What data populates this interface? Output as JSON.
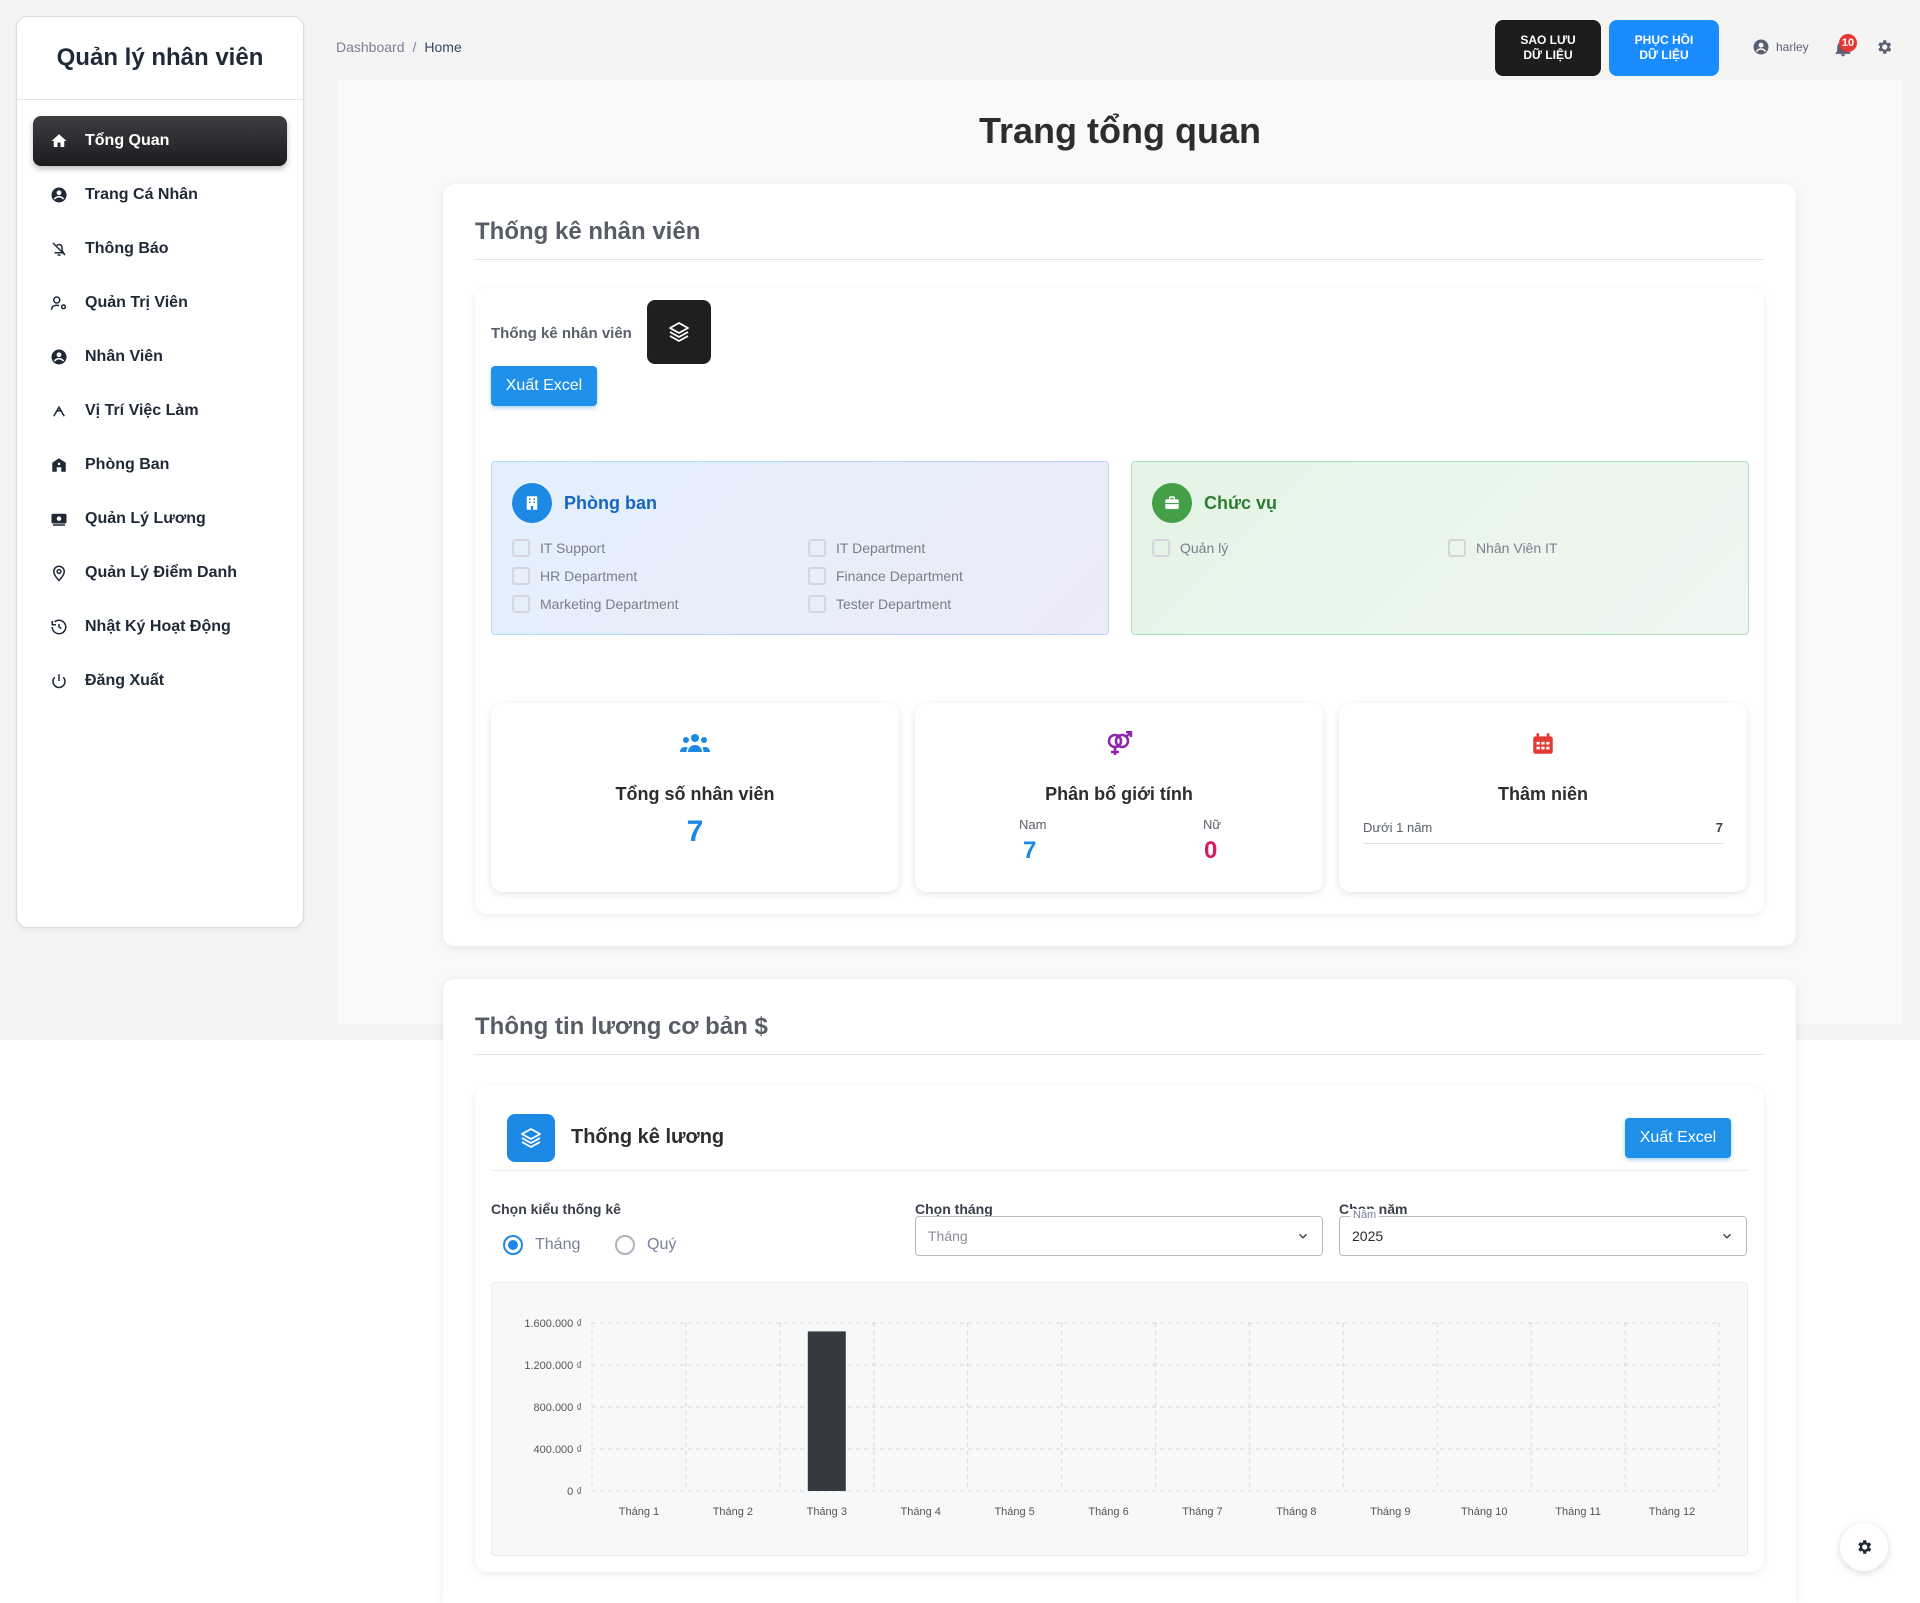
{
  "app": {
    "brand": "Quản lý nhân viên"
  },
  "sidebar": {
    "items": [
      {
        "label": "Tổng Quan",
        "icon": "home-icon",
        "active": true
      },
      {
        "label": "Trang Cá Nhân",
        "icon": "user-circle-icon"
      },
      {
        "label": "Thông Báo",
        "icon": "bell-off-icon"
      },
      {
        "label": "Quản Trị Viên",
        "icon": "user-gear-icon"
      },
      {
        "label": "Nhân Viên",
        "icon": "user-circle-icon"
      },
      {
        "label": "Vị Trí Việc Làm",
        "icon": "radar-icon"
      },
      {
        "label": "Phòng Ban",
        "icon": "building-icon"
      },
      {
        "label": "Quản Lý Lương",
        "icon": "money-icon"
      },
      {
        "label": "Quản Lý Điểm Danh",
        "icon": "location-icon"
      },
      {
        "label": "Nhật Ký Hoạt Động",
        "icon": "history-icon"
      },
      {
        "label": "Đăng Xuất",
        "icon": "power-icon"
      }
    ]
  },
  "topbar": {
    "breadcrumb": {
      "root": "Dashboard",
      "sep": "/",
      "current": "Home"
    },
    "backup_line1": "SAO LƯU",
    "backup_line2": "DỮ LIỆU",
    "restore_line1": "PHỤC HỒI",
    "restore_line2": "DỮ LIỆU",
    "username": "harley",
    "notif_count": "10"
  },
  "page": {
    "title": "Trang tổng quan"
  },
  "employee_stats": {
    "section_title": "Thống kê nhân viên",
    "label": "Thống kê nhân viên",
    "export_label": "Xuất Excel",
    "departments": {
      "title": "Phòng ban",
      "items": [
        "IT Support",
        "IT Department",
        "HR Department",
        "Finance Department",
        "Marketing Department",
        "Tester Department"
      ]
    },
    "positions": {
      "title": "Chức vụ",
      "items": [
        "Quản lý",
        "Nhân Viên IT"
      ]
    },
    "total": {
      "title": "Tổng số nhân viên",
      "value": "7"
    },
    "gender": {
      "title": "Phân bổ giới tính",
      "male_label": "Nam",
      "male_value": "7",
      "female_label": "Nữ",
      "female_value": "0"
    },
    "seniority": {
      "title": "Thâm niên",
      "row_label": "Dưới 1 năm",
      "row_value": "7"
    }
  },
  "salary": {
    "section_title": "Thông tin lương cơ bản $",
    "title": "Thống kê lương",
    "export_label": "Xuất Excel",
    "type_label": "Chọn kiểu thống kê",
    "type_options": [
      "Tháng",
      "Quý"
    ],
    "type_selected": "Tháng",
    "month_label": "Chọn tháng",
    "month_placeholder": "Tháng",
    "year_label": "Chọn năm",
    "year_legend": "Năm",
    "year_value": "2025"
  },
  "chart_data": {
    "type": "bar",
    "categories": [
      "Tháng 1",
      "Tháng 2",
      "Tháng 3",
      "Tháng 4",
      "Tháng 5",
      "Tháng 6",
      "Tháng 7",
      "Tháng 8",
      "Tháng 9",
      "Tháng 10",
      "Tháng 11",
      "Tháng 12"
    ],
    "values": [
      0,
      0,
      1520000,
      0,
      0,
      0,
      0,
      0,
      0,
      0,
      0,
      0
    ],
    "ylim": [
      0,
      1600000
    ],
    "yticks": [
      0,
      400000,
      800000,
      1200000,
      1600000
    ],
    "ytick_labels": [
      "0 ₫",
      "400.000 ₫",
      "800.000 ₫",
      "1.200.000 ₫",
      "1.600.000 ₫"
    ],
    "grid": true,
    "bar_color": "#343a40"
  },
  "colors": {
    "accent": "#1e90ea",
    "dark": "#1c1c1e",
    "female": "#d81b60",
    "male": "#1e88e5",
    "dept": "#1565c0",
    "pos": "#2e7d32"
  }
}
